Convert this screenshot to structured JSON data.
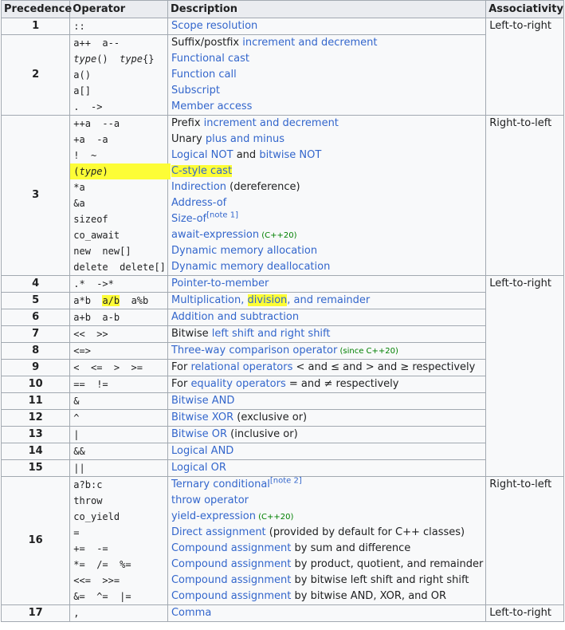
{
  "headers": {
    "precedence": "Precedence",
    "operator": "Operator",
    "description": "Description",
    "associativity": "Associativity"
  },
  "rows": [
    {
      "prec": "1",
      "assoc": "Left-to-right",
      "lines": [
        {
          "op": "::",
          "desc": [
            {
              "t": "Scope resolution",
              "l": true
            }
          ]
        }
      ]
    },
    {
      "prec": "2",
      "assoc": "",
      "lines": [
        {
          "op": "a++  a--",
          "desc": [
            {
              "t": "Suffix/postfix ",
              "l": false
            },
            {
              "t": "increment and decrement",
              "l": true
            }
          ]
        },
        {
          "op": "type()  type{}",
          "italic_op": true,
          "desc": [
            {
              "t": "Functional cast",
              "l": true
            }
          ]
        },
        {
          "op": "a()",
          "desc": [
            {
              "t": "Function call",
              "l": true
            }
          ]
        },
        {
          "op": "a[]",
          "desc": [
            {
              "t": "Subscript",
              "l": true
            }
          ]
        },
        {
          "op": ".  ->",
          "desc": [
            {
              "t": "Member access",
              "l": true
            }
          ]
        }
      ]
    },
    {
      "prec": "3",
      "assoc": "Right-to-left",
      "lines": [
        {
          "op": "++a  --a",
          "desc": [
            {
              "t": "Prefix ",
              "l": false
            },
            {
              "t": "increment and decrement",
              "l": true
            }
          ]
        },
        {
          "op": "+a  -a",
          "desc": [
            {
              "t": "Unary ",
              "l": false
            },
            {
              "t": "plus and minus",
              "l": true
            }
          ]
        },
        {
          "op": "!  ~",
          "desc": [
            {
              "t": "Logical NOT",
              "l": true
            },
            {
              "t": " and ",
              "l": false
            },
            {
              "t": "bitwise NOT",
              "l": true
            }
          ]
        },
        {
          "op": "(type)",
          "highlight": true,
          "desc": [
            {
              "t": "C-style cast",
              "l": true,
              "h": true
            }
          ]
        },
        {
          "op": "*a",
          "desc": [
            {
              "t": "Indirection",
              "l": true
            },
            {
              "t": " (dereference)",
              "l": false
            }
          ]
        },
        {
          "op": "&a",
          "desc": [
            {
              "t": "Address-of",
              "l": true
            }
          ]
        },
        {
          "op": "sizeof",
          "desc": [
            {
              "t": "Size-of",
              "l": true
            },
            {
              "t": "[note 1]",
              "sup": true
            }
          ]
        },
        {
          "op": "co_await",
          "desc": [
            {
              "t": "await-expression",
              "l": true
            },
            {
              "t": " (C++20)",
              "small": true
            }
          ]
        },
        {
          "op": "new  new[]",
          "desc": [
            {
              "t": "Dynamic memory allocation",
              "l": true
            }
          ]
        },
        {
          "op": "delete  delete[]",
          "desc": [
            {
              "t": "Dynamic memory deallocation",
              "l": true
            }
          ]
        }
      ]
    },
    {
      "prec": "4",
      "assoc": "Left-to-right",
      "lines": [
        {
          "op": ".*  ->*",
          "desc": [
            {
              "t": "Pointer-to-member",
              "l": true
            }
          ]
        }
      ]
    },
    {
      "prec": "5",
      "assoc": "",
      "lines": [
        {
          "op5": true,
          "op": "a*b  a/b  a%b",
          "desc": [
            {
              "t": "Multiplication, ",
              "l": true
            },
            {
              "t": "division",
              "l": true,
              "h": true
            },
            {
              "t": ", and remainder",
              "l": true
            }
          ]
        }
      ]
    },
    {
      "prec": "6",
      "assoc": "",
      "lines": [
        {
          "op": "a+b  a-b",
          "desc": [
            {
              "t": "Addition and subtraction",
              "l": true
            }
          ]
        }
      ]
    },
    {
      "prec": "7",
      "assoc": "",
      "lines": [
        {
          "op": "<<  >>",
          "desc": [
            {
              "t": "Bitwise ",
              "l": false
            },
            {
              "t": "left shift and right shift",
              "l": true
            }
          ]
        }
      ]
    },
    {
      "prec": "8",
      "assoc": "",
      "lines": [
        {
          "op": "<=>",
          "desc": [
            {
              "t": "Three-way comparison operator",
              "l": true
            },
            {
              "t": " (since C++20)",
              "small": true
            }
          ]
        }
      ]
    },
    {
      "prec": "9",
      "assoc": "",
      "lines": [
        {
          "op": "<  <=  >  >=",
          "desc": [
            {
              "t": "For ",
              "l": false
            },
            {
              "t": "relational operators",
              "l": true
            },
            {
              "t": " < and ≤ and > and ≥ respectively",
              "l": false
            }
          ]
        }
      ]
    },
    {
      "prec": "10",
      "assoc": "",
      "lines": [
        {
          "op": "==  !=",
          "desc": [
            {
              "t": "For ",
              "l": false
            },
            {
              "t": "equality operators",
              "l": true
            },
            {
              "t": " = and ≠ respectively",
              "l": false
            }
          ]
        }
      ]
    },
    {
      "prec": "11",
      "assoc": "",
      "lines": [
        {
          "op": "&",
          "desc": [
            {
              "t": "Bitwise AND",
              "l": true
            }
          ]
        }
      ]
    },
    {
      "prec": "12",
      "assoc": "",
      "lines": [
        {
          "op": "^",
          "desc": [
            {
              "t": "Bitwise XOR",
              "l": true
            },
            {
              "t": " (exclusive or)",
              "l": false
            }
          ]
        }
      ]
    },
    {
      "prec": "13",
      "assoc": "",
      "lines": [
        {
          "op": "|",
          "desc": [
            {
              "t": "Bitwise OR",
              "l": true
            },
            {
              "t": " (inclusive or)",
              "l": false
            }
          ]
        }
      ]
    },
    {
      "prec": "14",
      "assoc": "",
      "lines": [
        {
          "op": "&&",
          "desc": [
            {
              "t": "Logical AND",
              "l": true
            }
          ]
        }
      ]
    },
    {
      "prec": "15",
      "assoc": "",
      "lines": [
        {
          "op": "||",
          "desc": [
            {
              "t": "Logical OR",
              "l": true
            }
          ]
        }
      ]
    },
    {
      "prec": "16",
      "assoc": "Right-to-left",
      "lines": [
        {
          "op": "a?b:c",
          "desc": [
            {
              "t": "Ternary conditional",
              "l": true
            },
            {
              "t": "[note 2]",
              "sup": true
            }
          ]
        },
        {
          "op": "throw",
          "desc": [
            {
              "t": "throw operator",
              "l": true
            }
          ]
        },
        {
          "op": "co_yield",
          "desc": [
            {
              "t": "yield-expression",
              "l": true
            },
            {
              "t": " (C++20)",
              "small": true
            }
          ]
        },
        {
          "op": "=",
          "desc": [
            {
              "t": "Direct assignment",
              "l": true
            },
            {
              "t": " (provided by default for C++ classes)",
              "l": false
            }
          ]
        },
        {
          "op": "+=  -=",
          "desc": [
            {
              "t": "Compound assignment",
              "l": true
            },
            {
              "t": " by sum and difference",
              "l": false
            }
          ]
        },
        {
          "op": "*=  /=  %=",
          "desc": [
            {
              "t": "Compound assignment",
              "l": true
            },
            {
              "t": " by product, quotient, and remainder",
              "l": false
            }
          ]
        },
        {
          "op": "<<=  >>=",
          "desc": [
            {
              "t": "Compound assignment",
              "l": true
            },
            {
              "t": " by bitwise left shift and right shift",
              "l": false
            }
          ]
        },
        {
          "op": "&=  ^=  |=",
          "desc": [
            {
              "t": "Compound assignment",
              "l": true
            },
            {
              "t": " by bitwise AND, XOR, and OR",
              "l": false
            }
          ]
        }
      ]
    },
    {
      "prec": "17",
      "assoc": "Left-to-right",
      "lines": [
        {
          "op": ",",
          "desc": [
            {
              "t": "Comma",
              "l": true
            }
          ]
        }
      ]
    }
  ],
  "assoc_spans": [
    {
      "start": 0,
      "span": 3,
      "text": "Left-to-right"
    },
    {
      "start": 2,
      "span": 1,
      "text": "Right-to-left"
    },
    {
      "start": 3,
      "span": 12,
      "text": "Left-to-right"
    },
    {
      "start": 15,
      "span": 1,
      "text": "Right-to-left"
    },
    {
      "start": 16,
      "span": 1,
      "text": "Left-to-right"
    }
  ]
}
